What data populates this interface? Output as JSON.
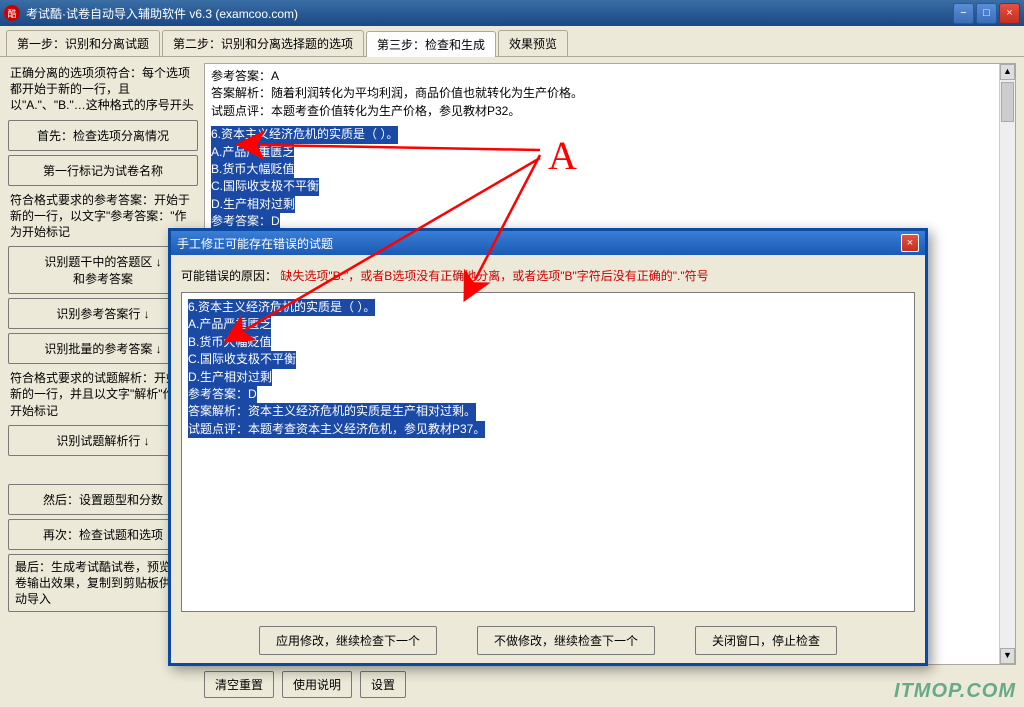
{
  "window": {
    "title": "考试酷·试卷自动导入辅助软件 v6.3 (examcoo.com)",
    "min": "−",
    "max": "□",
    "close": "×"
  },
  "tabs": {
    "t1": "第一步：识别和分离试题",
    "t2": "第二步：识别和分离选择题的选项",
    "t3": "第三步：检查和生成",
    "t4": "效果预览"
  },
  "left": {
    "desc1": "正确分离的选项须符合：每个选项都开始于新的一行，且以\"A.\"、\"B.\"…这种格式的序号开头",
    "btn1": "首先：检查选项分离情况",
    "btn2": "第一行标记为试卷名称",
    "desc2": "符合格式要求的参考答案：开始于新的一行，以文字\"参考答案：\"作为开始标记",
    "btn3": "识别题干中的答题区 ↓\n和参考答案",
    "btn4": "识别参考答案行 ↓",
    "btn5": "识别批量的参考答案 ↓",
    "desc3": "符合格式要求的试题解析：开始于新的一行，并且以文字\"解析\"作为开始标记",
    "btn6": "识别试题解析行 ↓",
    "btn8": "然后：设置题型和分数",
    "btn9": "再次：检查试题和选项",
    "btn10": "最后：生成考试酷试卷，预览试卷输出效果，复制到剪贴板供自动导入"
  },
  "topcontent": {
    "l1": "参考答案：A",
    "l2": "答案解析：随着利润转化为平均利润，商品价值也就转化为生产价格。",
    "l3": "试题点评：本题考查价值转化为生产价格，参见教材P32。",
    "h1": "6.资本主义经济危机的实质是（  ）。",
    "h2": "A.产品严重匮乏",
    "h3": "B.货币大幅贬值",
    "h4": "C.国际收支极不平衡",
    "h5": "D.生产相对过剩",
    "h6": "参考答案：D",
    "h7": "答案解析：资本主义经济危机的实质是生产相对过剩。",
    "h8": "试题点评：本题考查资本主义经济危机，参见教材P37。"
  },
  "modal": {
    "title": "手工修正可能存在错误的试题",
    "errlabel": "可能错误的原因：",
    "errtext": "缺失选项\"B.\"，或者B选项没有正确地分离，或者选项\"B\"字符后没有正确的\".\"符号",
    "e1": "6.资本主义经济危机的实质是（  ）。",
    "e2": "A.产品严重匮乏",
    "e3": "B.货币大幅贬值",
    "e4": "C.国际收支极不平衡",
    "e5": "D.生产相对过剩",
    "e6": "参考答案：D",
    "e7": "答案解析：资本主义经济危机的实质是生产相对过剩。",
    "e8": "试题点评：本题考查资本主义经济危机，参见教材P37。",
    "btn1": "应用修改，继续检查下一个",
    "btn2": "不做修改，继续检查下一个",
    "btn3": "关闭窗口，停止检查"
  },
  "bottom": {
    "b1": "清空重置",
    "b2": "使用说明",
    "b3": "设置"
  },
  "annotation": {
    "letter": "A"
  },
  "watermark": "ITMOP.COM"
}
